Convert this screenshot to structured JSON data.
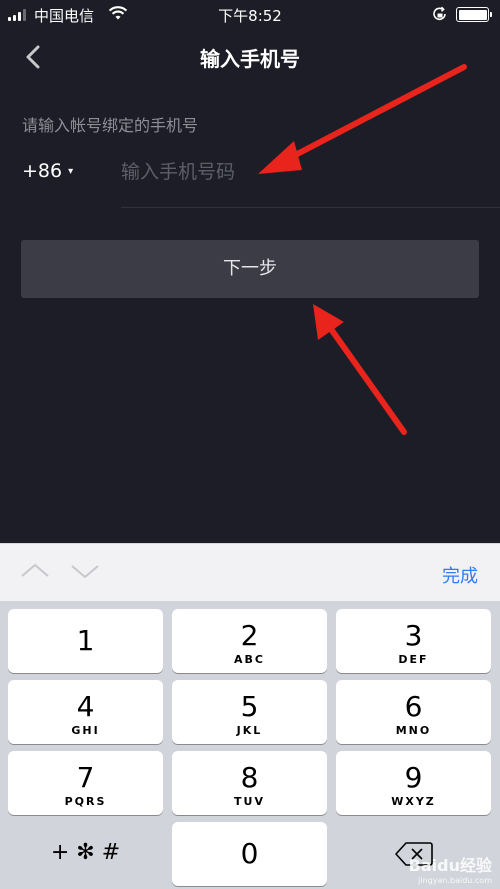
{
  "status_bar": {
    "carrier": "中国电信",
    "time": "下午8:52"
  },
  "nav": {
    "title": "输入手机号",
    "back_icon": "chevron-left-icon"
  },
  "form": {
    "hint": "请输入帐号绑定的手机号",
    "country_code": "+86",
    "caret": "▾",
    "phone_placeholder": "输入手机号码",
    "phone_value": "",
    "next_label": "下一步"
  },
  "keyboard": {
    "done_label": "完成",
    "keys": [
      {
        "num": "1",
        "letters": ""
      },
      {
        "num": "2",
        "letters": "ABC"
      },
      {
        "num": "3",
        "letters": "DEF"
      },
      {
        "num": "4",
        "letters": "GHI"
      },
      {
        "num": "5",
        "letters": "JKL"
      },
      {
        "num": "6",
        "letters": "MNO"
      },
      {
        "num": "7",
        "letters": "PQRS"
      },
      {
        "num": "8",
        "letters": "TUV"
      },
      {
        "num": "9",
        "letters": "WXYZ"
      },
      {
        "num": "0",
        "letters": ""
      }
    ],
    "symbols_label": "+ ✻ #",
    "delete_icon": "backspace-icon"
  },
  "watermark": {
    "text": "Baidu经验",
    "url": "jingyan.baidu.com"
  },
  "colors": {
    "background": "#1c1d26",
    "button": "#3b3c46",
    "accent_blue": "#2f7cf6",
    "annotation_red": "#e8241c"
  }
}
